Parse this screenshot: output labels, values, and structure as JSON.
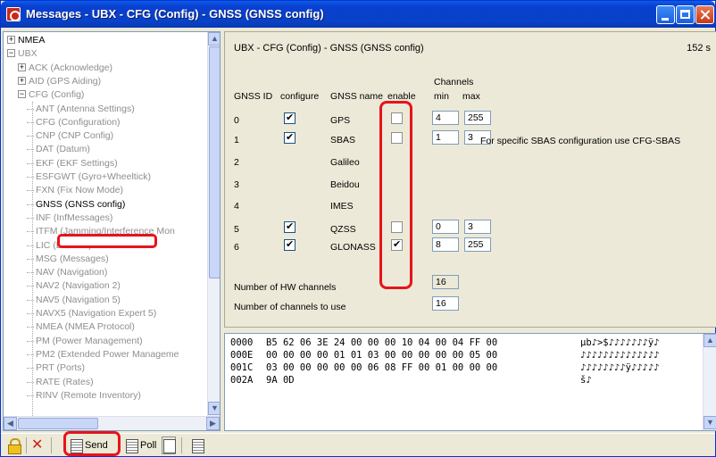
{
  "window": {
    "title": "Messages - UBX - CFG (Config) - GNSS (GNSS config)"
  },
  "tree": {
    "items": [
      {
        "label": "NMEA",
        "level": 0,
        "expander": "+",
        "dark": true
      },
      {
        "label": "UBX",
        "level": 0,
        "expander": "−",
        "dark": false
      },
      {
        "label": "ACK (Acknowledge)",
        "level": 1,
        "expander": "+",
        "dark": false
      },
      {
        "label": "AID (GPS Aiding)",
        "level": 1,
        "expander": "+",
        "dark": false
      },
      {
        "label": "CFG (Config)",
        "level": 1,
        "expander": "−",
        "dark": false
      },
      {
        "label": "ANT (Antenna Settings)",
        "level": 2,
        "expander": "",
        "dark": false
      },
      {
        "label": "CFG (Configuration)",
        "level": 2,
        "expander": "",
        "dark": false
      },
      {
        "label": "CNP (CNP Config)",
        "level": 2,
        "expander": "",
        "dark": false
      },
      {
        "label": "DAT (Datum)",
        "level": 2,
        "expander": "",
        "dark": false
      },
      {
        "label": "EKF (EKF Settings)",
        "level": 2,
        "expander": "",
        "dark": false
      },
      {
        "label": "ESFGWT (Gyro+Wheeltick)",
        "level": 2,
        "expander": "",
        "dark": false
      },
      {
        "label": "FXN (Fix Now Mode)",
        "level": 2,
        "expander": "",
        "dark": false
      },
      {
        "label": "GNSS (GNSS config)",
        "level": 2,
        "expander": "",
        "dark": false,
        "selected": true
      },
      {
        "label": "INF (InfMessages)",
        "level": 2,
        "expander": "",
        "dark": false
      },
      {
        "label": "ITFM (Jamming/Interference Mon",
        "level": 2,
        "expander": "",
        "dark": false
      },
      {
        "label": "LIC (License)",
        "level": 2,
        "expander": "",
        "dark": false
      },
      {
        "label": "MSG (Messages)",
        "level": 2,
        "expander": "",
        "dark": false
      },
      {
        "label": "NAV (Navigation)",
        "level": 2,
        "expander": "",
        "dark": false
      },
      {
        "label": "NAV2 (Navigation 2)",
        "level": 2,
        "expander": "",
        "dark": false
      },
      {
        "label": "NAV5 (Navigation 5)",
        "level": 2,
        "expander": "",
        "dark": false
      },
      {
        "label": "NAVX5 (Navigation Expert 5)",
        "level": 2,
        "expander": "",
        "dark": false
      },
      {
        "label": "NMEA (NMEA Protocol)",
        "level": 2,
        "expander": "",
        "dark": false
      },
      {
        "label": "PM (Power Management)",
        "level": 2,
        "expander": "",
        "dark": false
      },
      {
        "label": "PM2 (Extended Power Manageme",
        "level": 2,
        "expander": "",
        "dark": false
      },
      {
        "label": "PRT (Ports)",
        "level": 2,
        "expander": "",
        "dark": false
      },
      {
        "label": "RATE (Rates)",
        "level": 2,
        "expander": "",
        "dark": false
      },
      {
        "label": "RINV (Remote Inventory)",
        "level": 2,
        "expander": "",
        "dark": false
      }
    ]
  },
  "config": {
    "header": "UBX - CFG (Config) - GNSS (GNSS config)",
    "time": "152 s",
    "columns": {
      "gnss_id": "GNSS ID",
      "configure": "configure",
      "gnss_name": "GNSS name",
      "enable": "enable",
      "channels": "Channels",
      "min": "min",
      "max": "max"
    },
    "rows": [
      {
        "id": "0",
        "name": "GPS",
        "configure": true,
        "enable": false,
        "min": "4",
        "max": "255",
        "has_fields": true
      },
      {
        "id": "1",
        "name": "SBAS",
        "configure": true,
        "enable": false,
        "min": "1",
        "max": "3",
        "has_fields": true
      },
      {
        "id": "2",
        "name": "Galileo",
        "has_fields": false
      },
      {
        "id": "3",
        "name": "Beidou",
        "has_fields": false
      },
      {
        "id": "4",
        "name": "IMES",
        "has_fields": false
      },
      {
        "id": "5",
        "name": "QZSS",
        "configure": true,
        "enable": false,
        "min": "0",
        "max": "3",
        "has_fields": true
      },
      {
        "id": "6",
        "name": "GLONASS",
        "configure": true,
        "enable": true,
        "min": "8",
        "max": "255",
        "has_fields": true
      }
    ],
    "sbas_note": "For specific SBAS configuration use CFG-SBAS",
    "hw_channels_label": "Number of HW channels",
    "hw_channels_value": "16",
    "use_channels_label": "Number of channels to use",
    "use_channels_value": "16"
  },
  "hex": {
    "rows": [
      {
        "offset": "0000",
        "bytes": "B5 62 06 3E 24 00 00 00 10 04 00 04 FF 00",
        "ascii": "µb♪>$♪♪♪♪♪♪♪ÿ♪"
      },
      {
        "offset": "000E",
        "bytes": "00 00 00 00 01 01 03 00 00 00 00 00 05 00",
        "ascii": "♪♪♪♪♪♪♪♪♪♪♪♪♪♪"
      },
      {
        "offset": "001C",
        "bytes": "03 00 00 00 00 00 06 08 FF 00 01 00 00 00",
        "ascii": "♪♪♪♪♪♪♪♪ÿ♪♪♪♪♪"
      },
      {
        "offset": "002A",
        "bytes": "9A 0D",
        "ascii": "š♪"
      }
    ]
  },
  "toolbar": {
    "send_label": "Send",
    "poll_label": "Poll"
  }
}
